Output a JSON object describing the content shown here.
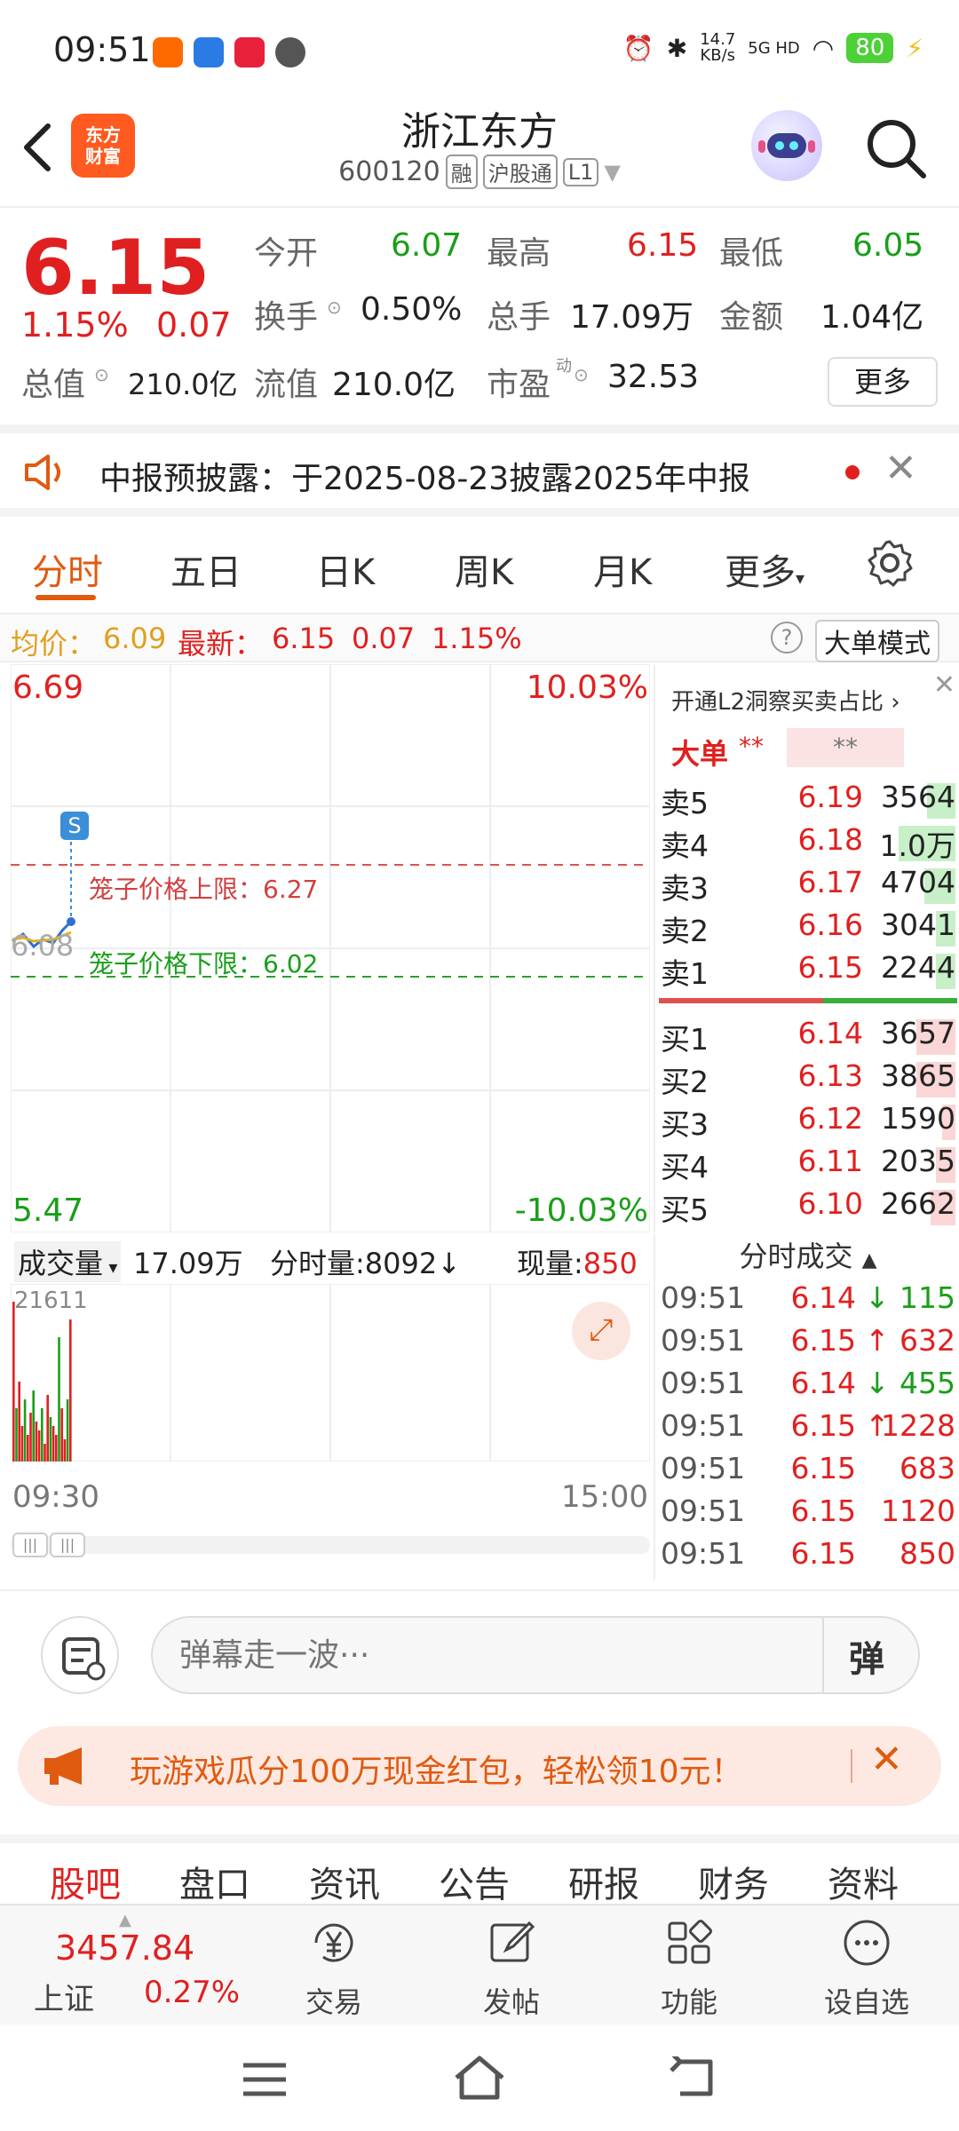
{
  "status_bar": {
    "time": "09:51",
    "network_speed": "14.7",
    "network_unit": "KB/s",
    "network_type": "5G HD",
    "battery": "80"
  },
  "header": {
    "logo_line1": "东方",
    "logo_line2": "财富",
    "title": "浙江东方",
    "code": "600120",
    "tags": [
      "融",
      "沪股通",
      "L1"
    ]
  },
  "quote": {
    "price": "6.15",
    "change_pct": "1.15%",
    "change": "0.07",
    "open_label": "今开",
    "open": "6.07",
    "high_label": "最高",
    "high": "6.15",
    "low_label": "最低",
    "low": "6.05",
    "turnover_label": "换手",
    "turnover": "0.50%",
    "volume_label": "总手",
    "volume": "17.09万",
    "amount_label": "金额",
    "amount": "1.04亿",
    "mktcap_label": "总值",
    "mktcap": "210.0亿",
    "float_label": "流值",
    "float": "210.0亿",
    "pe_label": "市盈",
    "pe_sup": "动",
    "pe": "32.53",
    "more": "更多"
  },
  "notice": {
    "text": "中报预披露：于2025-08-23披露2025年中报"
  },
  "tabs": [
    "分时",
    "五日",
    "日K",
    "周K",
    "月K",
    "更多"
  ],
  "info_line": {
    "avg_label": "均价：",
    "avg": "6.09",
    "latest_label": "最新：",
    "latest": "6.15",
    "change": "0.07",
    "change_pct": "1.15%",
    "big_mode": "大单模式"
  },
  "chart": {
    "top_price": "6.69",
    "top_pct": "10.03%",
    "bottom_price": "5.47",
    "bottom_pct": "-10.03%",
    "center_price": "6.08",
    "s_marker": "S",
    "cage_upper": "笼子价格上限：6.27",
    "cage_lower": "笼子价格下限：6.02",
    "time_start": "09:30",
    "time_end": "15:00"
  },
  "volume_panel": {
    "label": "成交量",
    "total": "17.09万",
    "minute_vol": "分时量:8092",
    "current_label": "现量:",
    "current": "850",
    "max_label": "21611"
  },
  "order_book": {
    "promo": "开通L2洞察买卖占比",
    "big_order_label": "大单",
    "big_order_val1": "**",
    "big_order_val2": "**",
    "asks": [
      {
        "label": "卖5",
        "price": "6.19",
        "vol": "3564"
      },
      {
        "label": "卖4",
        "price": "6.18",
        "vol": "1.0万"
      },
      {
        "label": "卖3",
        "price": "6.17",
        "vol": "4704"
      },
      {
        "label": "卖2",
        "price": "6.16",
        "vol": "3041"
      },
      {
        "label": "卖1",
        "price": "6.15",
        "vol": "2244"
      }
    ],
    "bids": [
      {
        "label": "买1",
        "price": "6.14",
        "vol": "3657"
      },
      {
        "label": "买2",
        "price": "6.13",
        "vol": "3865"
      },
      {
        "label": "买3",
        "price": "6.12",
        "vol": "1590"
      },
      {
        "label": "买4",
        "price": "6.11",
        "vol": "2035"
      },
      {
        "label": "买5",
        "price": "6.10",
        "vol": "2662"
      }
    ]
  },
  "trades": {
    "title": "分时成交",
    "rows": [
      {
        "time": "09:51",
        "price": "6.14",
        "dir": "↓",
        "vol": "115"
      },
      {
        "time": "09:51",
        "price": "6.15",
        "dir": "↑",
        "vol": "632"
      },
      {
        "time": "09:51",
        "price": "6.14",
        "dir": "↓",
        "vol": "455"
      },
      {
        "time": "09:51",
        "price": "6.15",
        "dir": "↑",
        "vol": "1228"
      },
      {
        "time": "09:51",
        "price": "6.15",
        "dir": "",
        "vol": "683"
      },
      {
        "time": "09:51",
        "price": "6.15",
        "dir": "",
        "vol": "1120"
      },
      {
        "time": "09:51",
        "price": "6.15",
        "dir": "",
        "vol": "850"
      }
    ]
  },
  "danmaku": {
    "placeholder": "弹幕走一波···",
    "toggle": "弹"
  },
  "promo": {
    "text": "玩游戏瓜分100万现金红包，轻松领10元！"
  },
  "bottom_tabs": [
    "股吧",
    "盘口",
    "资讯",
    "公告",
    "研报",
    "财务",
    "资料"
  ],
  "bottom_bar": {
    "index_value": "3457.84",
    "index_name": "上证",
    "index_change": "0.27%",
    "items": [
      "交易",
      "发帖",
      "功能",
      "设自选"
    ]
  },
  "colors": {
    "up": "#e02020",
    "down": "#1a9e1a",
    "accent": "#e05a10"
  }
}
